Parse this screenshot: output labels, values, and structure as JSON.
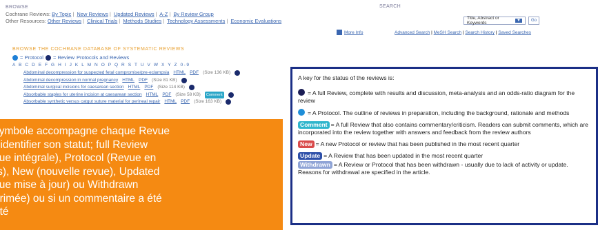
{
  "browse": {
    "label": "BROWSE",
    "row1_lead": "Cochrane Reviews:",
    "row1_links": [
      "By Topic",
      "New Reviews",
      "Updated Reviews",
      "A-Z",
      "By Review Group"
    ],
    "row2_lead": "Other Resources:",
    "row2_links": [
      "Other Reviews",
      "Clinical Trials",
      "Methods Studies",
      "Technology Assessments",
      "Economic Evaluations"
    ]
  },
  "search": {
    "label": "SEARCH",
    "select_value": "Title, Abstract or Keywords",
    "go_label": "Go",
    "more_info": "More Info",
    "links": [
      "Advanced Search",
      "MeSH Search",
      "Search History",
      "Saved Searches"
    ]
  },
  "middle": {
    "section_title": "BROWSE THE COCHRANE DATABASE OF SYSTEMATIC REVIEWS",
    "legend_protocol": "= Protocol",
    "legend_review": "= Review",
    "legend_tail": "Protocols and Reviews",
    "alphabet": "A B C D E F G H I J K L M N O P Q R S T U V W X Y Z 0-9",
    "rows": [
      {
        "title": "Abdominal decompression for suspected fetal compromise/pre-eclampsia",
        "html": "HTML",
        "pdf": "PDF",
        "size": "(Size 136 KB)"
      },
      {
        "title": "Abdominal decompression in normal pregnancy",
        "html": "HTML",
        "pdf": "PDF",
        "size": "(Size 81 KB)"
      },
      {
        "title": "Abdominal surgical incisions for caesarean section",
        "html": "HTML",
        "pdf": "PDF",
        "size": "(Size 114 KB)"
      },
      {
        "title": "Absorbable staples for uterine incision at caesarean section",
        "html": "HTML",
        "pdf": "PDF",
        "size": "(Size 58 KB)",
        "badge": "Comment"
      },
      {
        "title": "Absorbable synthetic versus catgut suture material for perineal repair",
        "html": "HTML",
        "pdf": "PDF",
        "size": "(Size 163 KB)"
      }
    ]
  },
  "caption": {
    "text": "symbole accompagne chaque Revue\nr identifier son statut; full Review\nvue intégrale), Protocol (Revue en\nrs), New (nouvelle revue), Updated\nvue mise à jour) ou Withdrawn\nprimée) ou si un commentaire a été\nuté"
  },
  "key": {
    "title": "A key for the status of the reviews is:",
    "review_text": "= A full Review, complete with results and discussion, meta-analysis and an odds-ratio diagram for the review",
    "protocol_text": "= A Protocol. The outline of reviews in preparation, including the background, rationale and methods",
    "comment_badge": "Comment",
    "comment_text": "= A full Review that also contains commentary/criticism. Readers can submit comments, which are incorporated into the review together with answers and feedback from the review authors",
    "new_badge": "New",
    "new_text": "= A new Protocol or review that has been published in the most recent quarter",
    "update_badge": "Update",
    "update_text": "= A Review that has been updated in the most recent quarter",
    "withdrawn_badge": "Withdrawn",
    "withdrawn_text": "= A Review or Protocol that has been withdrawn - usually due to lack of activity or update. Reasons for withdrawal are specified in the article."
  }
}
